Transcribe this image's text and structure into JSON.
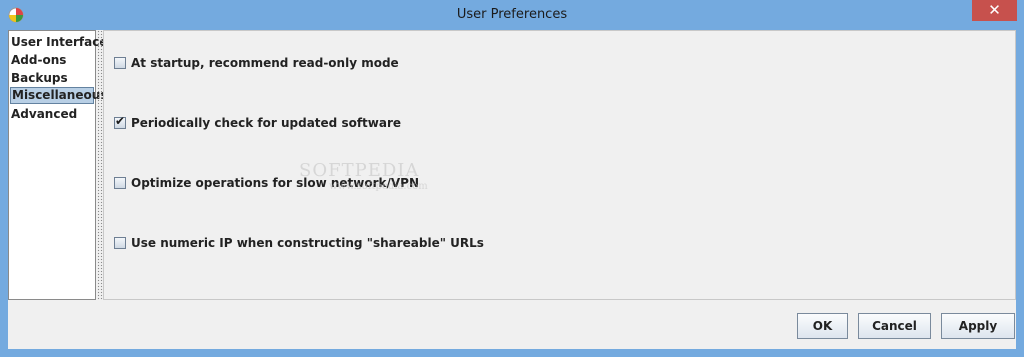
{
  "window": {
    "title": "User Preferences",
    "close_glyph": "✕"
  },
  "sidebar": {
    "items": [
      {
        "label": "User Interface",
        "selected": false
      },
      {
        "label": "Add-ons",
        "selected": false
      },
      {
        "label": "Backups",
        "selected": false
      },
      {
        "label": "Miscellaneous",
        "selected": true
      },
      {
        "label": "Advanced",
        "selected": false
      }
    ]
  },
  "options": [
    {
      "label": "At startup, recommend read-only mode",
      "checked": false
    },
    {
      "label": "Periodically check for updated software",
      "checked": true
    },
    {
      "label": "Optimize operations for slow network/VPN",
      "checked": false
    },
    {
      "label": "Use numeric IP when constructing \"shareable\" URLs",
      "checked": false
    }
  ],
  "watermark": {
    "brand": "SOFTPEDIA",
    "url": "www.softpedia.com"
  },
  "buttons": {
    "ok": "OK",
    "cancel": "Cancel",
    "apply": "Apply"
  },
  "icons": {
    "app": "app-icon",
    "check": "✔"
  }
}
